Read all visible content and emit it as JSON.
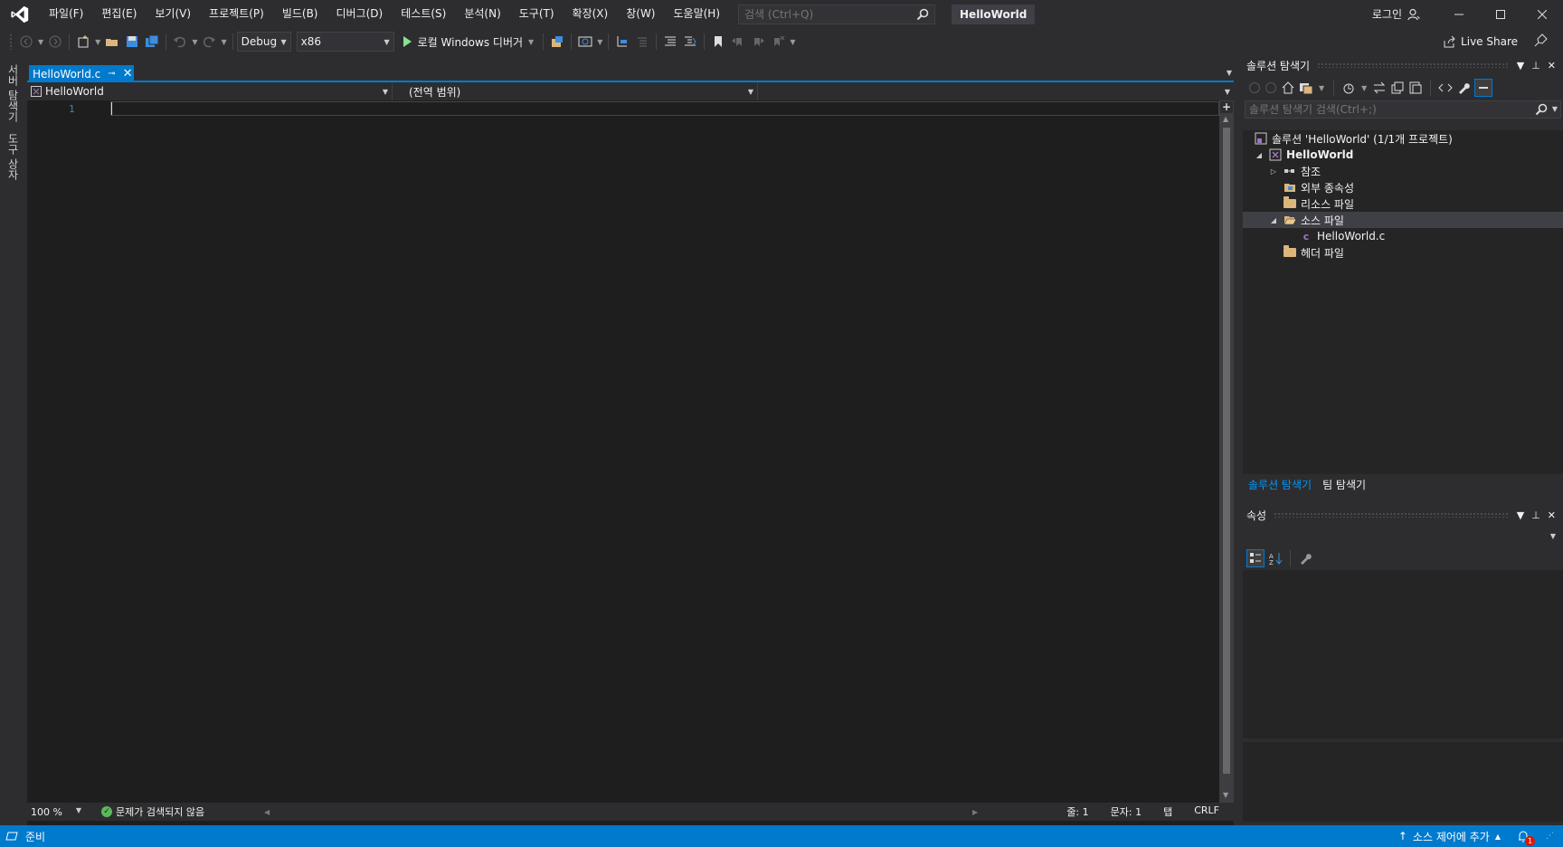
{
  "menu": [
    "파일(F)",
    "편집(E)",
    "보기(V)",
    "프로젝트(P)",
    "빌드(B)",
    "디버그(D)",
    "테스트(S)",
    "분석(N)",
    "도구(T)",
    "확장(X)",
    "창(W)",
    "도움말(H)"
  ],
  "search": {
    "placeholder": "검색 (Ctrl+Q)"
  },
  "solution_title": "HelloWorld",
  "login": "로그인",
  "toolbar": {
    "config": "Debug",
    "platform": "x86",
    "run_label": "로컬 Windows 디버거",
    "live_share": "Live Share"
  },
  "left_tabs": [
    "서버 탐색기",
    "도구 상자"
  ],
  "document": {
    "tab_label": "HelloWorld.c",
    "nav_project": "HelloWorld",
    "nav_scope": "(전역 범위)",
    "line_number": "1"
  },
  "editor_status": {
    "zoom": "100 %",
    "issues": "문제가 검색되지 않음",
    "line": "줄: 1",
    "col": "문자: 1",
    "tab": "탭",
    "eol": "CRLF"
  },
  "solution_explorer": {
    "title": "솔루션 탐색기",
    "search_placeholder": "솔루션 탐색기 검색(Ctrl+;)",
    "tree": [
      {
        "label": "솔루션 'HelloWorld' (1/1개 프로젝트)",
        "level": 0
      },
      {
        "label": "HelloWorld",
        "level": 1
      },
      {
        "label": "참조",
        "level": 2
      },
      {
        "label": "외부 종속성",
        "level": 2
      },
      {
        "label": "리소스 파일",
        "level": 2
      },
      {
        "label": "소스 파일",
        "level": 2
      },
      {
        "label": "HelloWorld.c",
        "level": 3
      },
      {
        "label": "헤더 파일",
        "level": 2
      }
    ],
    "tabs": [
      "솔루션 탐색기",
      "팀 탐색기"
    ]
  },
  "properties": {
    "title": "속성"
  },
  "statusbar": {
    "ready": "준비",
    "source_control": "소스 제어에 추가",
    "notification_count": "1"
  },
  "colors": {
    "accent": "#007acc",
    "background": "#2d2d30",
    "editor": "#1e1e1e",
    "folder": "#dcb67a",
    "line_number": "#2b91af"
  }
}
